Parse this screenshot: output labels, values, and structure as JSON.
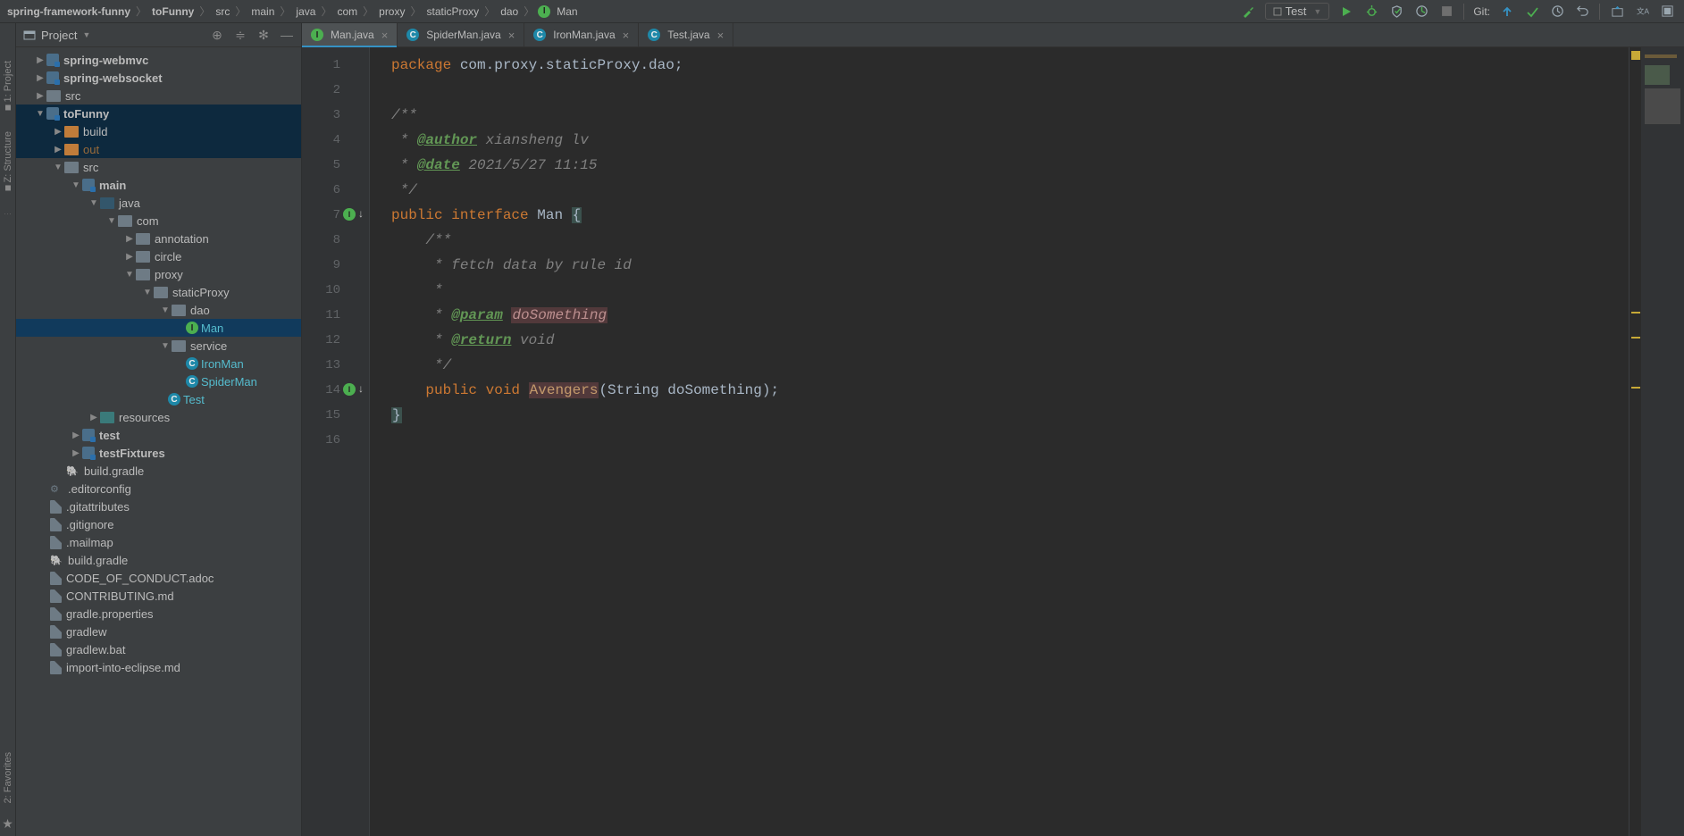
{
  "breadcrumbs": [
    "spring-framework-funny",
    "toFunny",
    "src",
    "main",
    "java",
    "com",
    "proxy",
    "staticProxy",
    "dao",
    "Man"
  ],
  "run_config": {
    "label": "Test"
  },
  "git_label": "Git:",
  "project_panel": {
    "title": "Project"
  },
  "left_tool": {
    "project": "1: Project",
    "structure": "Z: Structure",
    "favorites": "2: Favorites"
  },
  "tree": {
    "webmvc": "spring-webmvc",
    "websocket": "spring-websocket",
    "src_top": "src",
    "toFunny": "toFunny",
    "build": "build",
    "out": "out",
    "src": "src",
    "main": "main",
    "java": "java",
    "com": "com",
    "annotation": "annotation",
    "circle": "circle",
    "proxy": "proxy",
    "staticProxy": "staticProxy",
    "dao": "dao",
    "Man": "Man",
    "service": "service",
    "IronMan": "IronMan",
    "SpiderMan": "SpiderMan",
    "Test": "Test",
    "resources": "resources",
    "test": "test",
    "testFixtures": "testFixtures",
    "build_gradle": "build.gradle",
    "editorconfig": ".editorconfig",
    "gitattributes": ".gitattributes",
    "gitignore": ".gitignore",
    "mailmap": ".mailmap",
    "build_gradle2": "build.gradle",
    "coc": "CODE_OF_CONDUCT.adoc",
    "contributing": "CONTRIBUTING.md",
    "gradle_props": "gradle.properties",
    "gradlew": "gradlew",
    "gradlew_bat": "gradlew.bat",
    "import_eclipse": "import-into-eclipse.md"
  },
  "tabs": [
    {
      "label": "Man.java",
      "icon": "i",
      "active": true
    },
    {
      "label": "SpiderMan.java",
      "icon": "c",
      "active": false
    },
    {
      "label": "IronMan.java",
      "icon": "c",
      "active": false
    },
    {
      "label": "Test.java",
      "icon": "c",
      "active": false
    }
  ],
  "code": {
    "package_kw": "package",
    "package_name": " com.proxy.staticProxy.dao",
    "doc_open": "/**",
    "doc_star": " *",
    "author_tag": "@author",
    "author_val": " xiansheng lv",
    "date_tag": "@date",
    "date_val": " 2021/5/27 11:15",
    "doc_close": " */",
    "public": "public",
    "interface": "interface",
    "class_name": " Man ",
    "brace_open": "{",
    "mdoc_open": "/**",
    "mdoc_desc": " * fetch data by rule id",
    "mdoc_star": " *",
    "param_tag": "@param",
    "param_name": "doSomething",
    "return_tag": "@return",
    "return_val": " void",
    "mdoc_close": " */",
    "void": "void",
    "method_name": "Avengers",
    "sig_rest": "(String doSomething);",
    "brace_close": "}"
  },
  "line_numbers": [
    "1",
    "2",
    "3",
    "4",
    "5",
    "6",
    "7",
    "8",
    "9",
    "10",
    "11",
    "12",
    "13",
    "14",
    "15",
    "16"
  ]
}
